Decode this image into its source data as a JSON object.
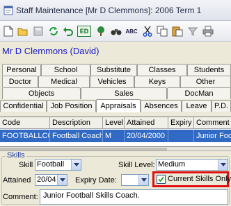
{
  "window": {
    "title": "Staff Maintenance  [Mr D Clemmons]:  2006 Term 1",
    "app_icon": "form-icon"
  },
  "toolbar": {
    "items": [
      {
        "name": "new-document-icon"
      },
      {
        "name": "open-folder-icon"
      },
      {
        "name": "save-disk-icon"
      },
      {
        "name": "refresh-icon"
      },
      {
        "name": "undo-icon"
      },
      {
        "name": "edit-icon",
        "label": "ED"
      },
      {
        "name": "family-tree-icon"
      },
      {
        "name": "search-binoculars-icon"
      },
      {
        "name": "spellcheck-icon",
        "label": "ABC"
      },
      {
        "name": "cut-icon"
      },
      {
        "name": "copy-icon"
      },
      {
        "name": "paste-icon"
      },
      {
        "name": "filter-icon"
      },
      {
        "name": "print-icon"
      }
    ]
  },
  "staff": {
    "name": "Mr D Clemmons (David)"
  },
  "tabs": {
    "row1": [
      "Personal",
      "School",
      "Substitute",
      "Classes",
      "Students"
    ],
    "row2": [
      "Doctor",
      "Medical",
      "Vehicles",
      "Keys",
      "Other"
    ],
    "row3": [
      "Objects",
      "Sales",
      "DocMan"
    ],
    "row4": [
      "Confidential",
      "Job Position",
      "Appraisals",
      "Absences",
      "Leave",
      "P.D."
    ]
  },
  "table": {
    "columns": [
      "Code",
      "Description",
      "Level",
      "Attained",
      "Expiry",
      "Comment"
    ],
    "rows": [
      [
        "FOOTBALLCOACH",
        "Football Coach",
        "M",
        "20/04/2000",
        "",
        "Junior Foot"
      ]
    ]
  },
  "skills": {
    "legend": "Skills",
    "skill_label": "Skill",
    "skill_value": "Football",
    "skill_level_label": "Skill Level:",
    "skill_level_value": "Medium",
    "attained_label": "Attained",
    "attained_value": "20/04",
    "expiry_label": "Expiry Date:",
    "expiry_value": "",
    "current_only_label": "Current Skills Only",
    "current_only_checked": true,
    "comment_label": "Comment:",
    "comment_value": "Junior Football Skills Coach."
  },
  "colors": {
    "selection": "#316ac5",
    "staff_name": "#1a1ac8",
    "highlight": "#e01010"
  }
}
